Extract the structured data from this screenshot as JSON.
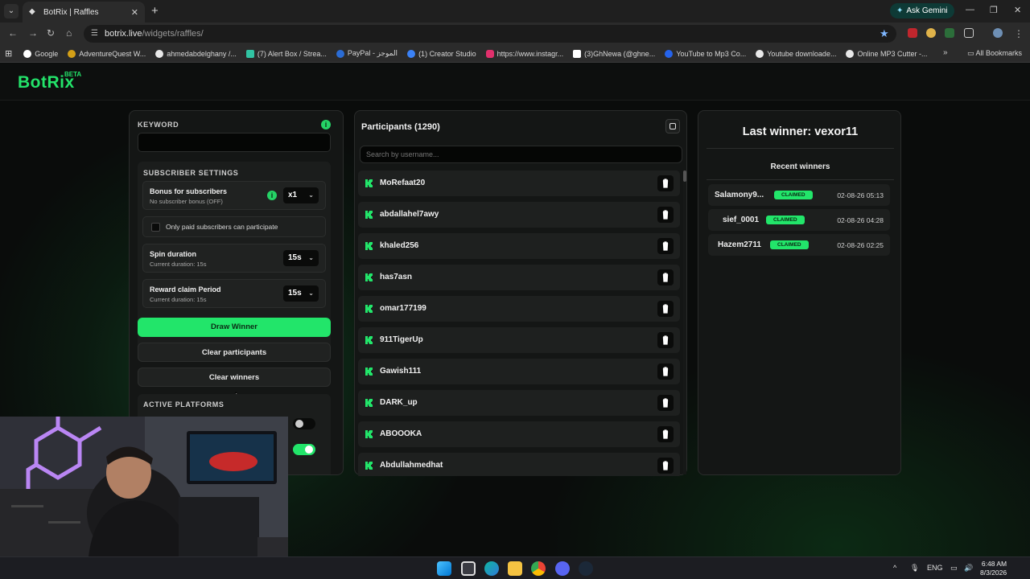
{
  "browser": {
    "tab_title": "BotRix | Raffles",
    "new_tab": "+",
    "tab_close": "✕",
    "ask_gemini": "Ask Gemini",
    "url_host": "botrix.live",
    "url_path": "/widgets/raffles/",
    "bookmarks": [
      {
        "label": "Google",
        "color": "#ffffff"
      },
      {
        "label": "AdventureQuest W...",
        "color": "#d4a017"
      },
      {
        "label": "ahmedabdelghany /...",
        "color": "#e8e8e8"
      },
      {
        "label": "(7) Alert Box / Strea...",
        "color": "#31c3a2"
      },
      {
        "label": "PayPal - الموجز",
        "color": "#2b6cd4"
      },
      {
        "label": "(1) Creator Studio",
        "color": "#3b82f6"
      },
      {
        "label": "https://www.instagr...",
        "color": "#e1306c"
      },
      {
        "label": "(3)GhNewa (@ghne...",
        "color": "#ffffff"
      },
      {
        "label": "YouTube to Mp3 Co...",
        "color": "#2563eb"
      },
      {
        "label": "Youtube downloade...",
        "color": "#e8e8e8"
      },
      {
        "label": "Online MP3 Cutter -...",
        "color": "#e8e8e8"
      }
    ],
    "all_bookmarks": "All Bookmarks",
    "bm_more": "»"
  },
  "app": {
    "logo": "BotRix",
    "beta": "BETA",
    "accent": "#22e56a"
  },
  "settings": {
    "keyword_label": "KEYWORD",
    "info_glyph": "i",
    "subscriber_label": "SUBSCRIBER SETTINGS",
    "bonus_title": "Bonus for subscribers",
    "bonus_sub": "No subscriber bonus (OFF)",
    "bonus_value": "x1",
    "paid_only": "Only paid subscribers can participate",
    "spin_title": "Spin duration",
    "spin_sub": "Current duration: 15s",
    "spin_value": "15s",
    "claim_title": "Reward claim Period",
    "claim_sub": "Current duration: 15s",
    "claim_value": "15s",
    "draw_winner": "Draw Winner",
    "clear_participants": "Clear participants",
    "clear_winners": "Clear winners",
    "platforms_label": "ACTIVE PLATFORMS"
  },
  "participants": {
    "title": "Participants (1290)",
    "search_placeholder": "Search by username...",
    "items": [
      "MoRefaat20",
      "abdallahel7awy",
      "khaled256",
      "has7asn",
      "omar177199",
      "911TigerUp",
      "Gawish111",
      "DARK_up",
      "ABOOOKA",
      "Abdullahmedhat"
    ]
  },
  "winners": {
    "last_winner": "Last winner: vexor11",
    "recent_title": "Recent winners",
    "items": [
      {
        "name": "Salamony9...",
        "badge": "CLAIMED",
        "time": "02-08-26 05:13"
      },
      {
        "name": "sief_0001",
        "badge": "CLAIMED",
        "time": "02-08-26 04:28"
      },
      {
        "name": "Hazem2711",
        "badge": "CLAIMED",
        "time": "02-08-26 02:25"
      }
    ]
  },
  "taskbar": {
    "lang": "ENG",
    "time": "6:48 AM",
    "date": "8/3/2026",
    "tray_up": "^"
  }
}
